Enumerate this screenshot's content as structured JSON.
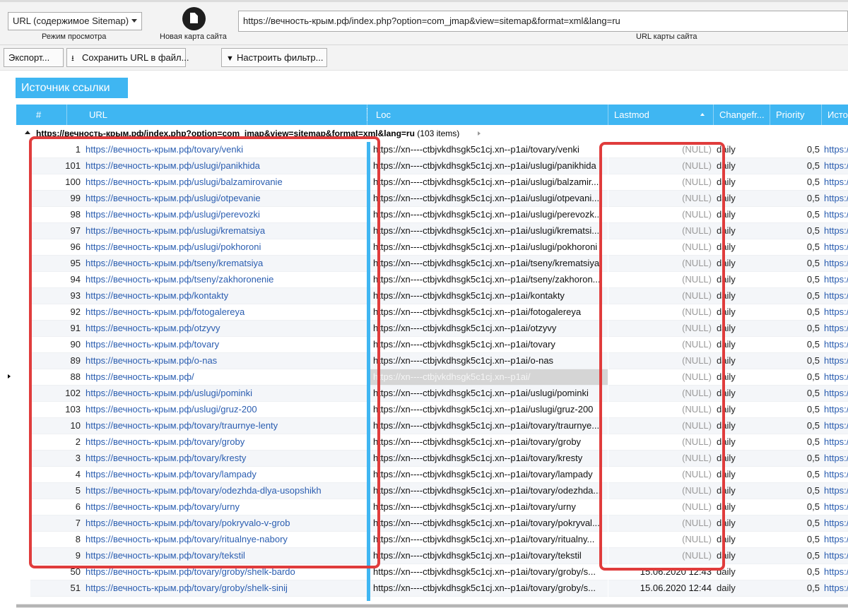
{
  "toolbar": {
    "view_mode_value": "URL (содержимое Sitemap)",
    "view_mode_caption": "Режим просмотра",
    "new_map_caption": "Новая карта сайта",
    "sitemap_url_value": "https://вечность-крым.рф/index.php?option=com_jmap&view=sitemap&format=xml&lang=ru",
    "sitemap_url_caption": "URL карты сайта",
    "export_label": "Экспорт...",
    "save_urls_label": "Сохранить URL в файл...",
    "filter_label": "Настроить фильтр..."
  },
  "group_panel": {
    "label": "Источник ссылки"
  },
  "grid": {
    "columns": {
      "num": "#",
      "url": "URL",
      "loc": "Loc",
      "lastmod": "Lastmod",
      "changefreq": "Changefr...",
      "priority": "Priority",
      "source": "Исто"
    },
    "group": {
      "title": "https://вечность-крым.рф/index.php?option=com_jmap&view=sitemap&format=xml&lang=ru",
      "count": "(103 items)"
    },
    "rows": [
      {
        "num": "1",
        "url": "https://вечность-крым.рф/tovary/venki",
        "loc": "https://xn----ctbjvkdhsgk5c1cj.xn--p1ai/tovary/venki",
        "lastmod": "(NULL)",
        "changefreq": "daily",
        "priority": "0,5",
        "source": "https:/"
      },
      {
        "num": "101",
        "url": "https://вечность-крым.рф/uslugi/panikhida",
        "loc": "https://xn----ctbjvkdhsgk5c1cj.xn--p1ai/uslugi/panikhida",
        "lastmod": "(NULL)",
        "changefreq": "daily",
        "priority": "0,5",
        "source": "https:/"
      },
      {
        "num": "100",
        "url": "https://вечность-крым.рф/uslugi/balzamirovanie",
        "loc": "https://xn----ctbjvkdhsgk5c1cj.xn--p1ai/uslugi/balzamir...",
        "lastmod": "(NULL)",
        "changefreq": "daily",
        "priority": "0,5",
        "source": "https:/"
      },
      {
        "num": "99",
        "url": "https://вечность-крым.рф/uslugi/otpevanie",
        "loc": "https://xn----ctbjvkdhsgk5c1cj.xn--p1ai/uslugi/otpevani...",
        "lastmod": "(NULL)",
        "changefreq": "daily",
        "priority": "0,5",
        "source": "https:/"
      },
      {
        "num": "98",
        "url": "https://вечность-крым.рф/uslugi/perevozki",
        "loc": "https://xn----ctbjvkdhsgk5c1cj.xn--p1ai/uslugi/perevozk...",
        "lastmod": "(NULL)",
        "changefreq": "daily",
        "priority": "0,5",
        "source": "https:/"
      },
      {
        "num": "97",
        "url": "https://вечность-крым.рф/uslugi/krematsiya",
        "loc": "https://xn----ctbjvkdhsgk5c1cj.xn--p1ai/uslugi/krematsi...",
        "lastmod": "(NULL)",
        "changefreq": "daily",
        "priority": "0,5",
        "source": "https:/"
      },
      {
        "num": "96",
        "url": "https://вечность-крым.рф/uslugi/pokhoroni",
        "loc": "https://xn----ctbjvkdhsgk5c1cj.xn--p1ai/uslugi/pokhoroni",
        "lastmod": "(NULL)",
        "changefreq": "daily",
        "priority": "0,5",
        "source": "https:/"
      },
      {
        "num": "95",
        "url": "https://вечность-крым.рф/tseny/krematsiya",
        "loc": "https://xn----ctbjvkdhsgk5c1cj.xn--p1ai/tseny/krematsiya",
        "lastmod": "(NULL)",
        "changefreq": "daily",
        "priority": "0,5",
        "source": "https:/"
      },
      {
        "num": "94",
        "url": "https://вечность-крым.рф/tseny/zakhoronenie",
        "loc": "https://xn----ctbjvkdhsgk5c1cj.xn--p1ai/tseny/zakhoron...",
        "lastmod": "(NULL)",
        "changefreq": "daily",
        "priority": "0,5",
        "source": "https:/"
      },
      {
        "num": "93",
        "url": "https://вечность-крым.рф/kontakty",
        "loc": "https://xn----ctbjvkdhsgk5c1cj.xn--p1ai/kontakty",
        "lastmod": "(NULL)",
        "changefreq": "daily",
        "priority": "0,5",
        "source": "https:/"
      },
      {
        "num": "92",
        "url": "https://вечность-крым.рф/fotogalereya",
        "loc": "https://xn----ctbjvkdhsgk5c1cj.xn--p1ai/fotogalereya",
        "lastmod": "(NULL)",
        "changefreq": "daily",
        "priority": "0,5",
        "source": "https:/"
      },
      {
        "num": "91",
        "url": "https://вечность-крым.рф/otzyvy",
        "loc": "https://xn----ctbjvkdhsgk5c1cj.xn--p1ai/otzyvy",
        "lastmod": "(NULL)",
        "changefreq": "daily",
        "priority": "0,5",
        "source": "https:/"
      },
      {
        "num": "90",
        "url": "https://вечность-крым.рф/tovary",
        "loc": "https://xn----ctbjvkdhsgk5c1cj.xn--p1ai/tovary",
        "lastmod": "(NULL)",
        "changefreq": "daily",
        "priority": "0,5",
        "source": "https:/"
      },
      {
        "num": "89",
        "url": "https://вечность-крым.рф/o-nas",
        "loc": "https://xn----ctbjvkdhsgk5c1cj.xn--p1ai/o-nas",
        "lastmod": "(NULL)",
        "changefreq": "daily",
        "priority": "0,5",
        "source": "https:/"
      },
      {
        "num": "88",
        "url": "https://вечность-крым.рф/",
        "loc": "https://xn----ctbjvkdhsgk5c1cj.xn--p1ai/",
        "lastmod": "(NULL)",
        "changefreq": "daily",
        "priority": "0,5",
        "source": "https:/",
        "selected": true
      },
      {
        "num": "102",
        "url": "https://вечность-крым.рф/uslugi/pominki",
        "loc": "https://xn----ctbjvkdhsgk5c1cj.xn--p1ai/uslugi/pominki",
        "lastmod": "(NULL)",
        "changefreq": "daily",
        "priority": "0,5",
        "source": "https:/"
      },
      {
        "num": "103",
        "url": "https://вечность-крым.рф/uslugi/gruz-200",
        "loc": "https://xn----ctbjvkdhsgk5c1cj.xn--p1ai/uslugi/gruz-200",
        "lastmod": "(NULL)",
        "changefreq": "daily",
        "priority": "0,5",
        "source": "https:/"
      },
      {
        "num": "10",
        "url": "https://вечность-крым.рф/tovary/traurnye-lenty",
        "loc": "https://xn----ctbjvkdhsgk5c1cj.xn--p1ai/tovary/traurnye...",
        "lastmod": "(NULL)",
        "changefreq": "daily",
        "priority": "0,5",
        "source": "https:/"
      },
      {
        "num": "2",
        "url": "https://вечность-крым.рф/tovary/groby",
        "loc": "https://xn----ctbjvkdhsgk5c1cj.xn--p1ai/tovary/groby",
        "lastmod": "(NULL)",
        "changefreq": "daily",
        "priority": "0,5",
        "source": "https:/"
      },
      {
        "num": "3",
        "url": "https://вечность-крым.рф/tovary/kresty",
        "loc": "https://xn----ctbjvkdhsgk5c1cj.xn--p1ai/tovary/kresty",
        "lastmod": "(NULL)",
        "changefreq": "daily",
        "priority": "0,5",
        "source": "https:/"
      },
      {
        "num": "4",
        "url": "https://вечность-крым.рф/tovary/lampady",
        "loc": "https://xn----ctbjvkdhsgk5c1cj.xn--p1ai/tovary/lampady",
        "lastmod": "(NULL)",
        "changefreq": "daily",
        "priority": "0,5",
        "source": "https:/"
      },
      {
        "num": "5",
        "url": "https://вечность-крым.рф/tovary/odezhda-dlya-usopshikh",
        "loc": "https://xn----ctbjvkdhsgk5c1cj.xn--p1ai/tovary/odezhda...",
        "lastmod": "(NULL)",
        "changefreq": "daily",
        "priority": "0,5",
        "source": "https:/"
      },
      {
        "num": "6",
        "url": "https://вечность-крым.рф/tovary/urny",
        "loc": "https://xn----ctbjvkdhsgk5c1cj.xn--p1ai/tovary/urny",
        "lastmod": "(NULL)",
        "changefreq": "daily",
        "priority": "0,5",
        "source": "https:/"
      },
      {
        "num": "7",
        "url": "https://вечность-крым.рф/tovary/pokryvalo-v-grob",
        "loc": "https://xn----ctbjvkdhsgk5c1cj.xn--p1ai/tovary/pokryval...",
        "lastmod": "(NULL)",
        "changefreq": "daily",
        "priority": "0,5",
        "source": "https:/"
      },
      {
        "num": "8",
        "url": "https://вечность-крым.рф/tovary/ritualnye-nabory",
        "loc": "https://xn----ctbjvkdhsgk5c1cj.xn--p1ai/tovary/ritualny...",
        "lastmod": "(NULL)",
        "changefreq": "daily",
        "priority": "0,5",
        "source": "https:/"
      },
      {
        "num": "9",
        "url": "https://вечность-крым.рф/tovary/tekstil",
        "loc": "https://xn----ctbjvkdhsgk5c1cj.xn--p1ai/tovary/tekstil",
        "lastmod": "(NULL)",
        "changefreq": "daily",
        "priority": "0,5",
        "source": "https:/"
      },
      {
        "num": "50",
        "url": "https://вечность-крым.рф/tovary/groby/shelk-bardo",
        "loc": "https://xn----ctbjvkdhsgk5c1cj.xn--p1ai/tovary/groby/s...",
        "lastmod": "15.06.2020 12:43",
        "changefreq": "daily",
        "priority": "0,5",
        "source": "https:/"
      },
      {
        "num": "51",
        "url": "https://вечность-крым.рф/tovary/groby/shelk-sinij",
        "loc": "https://xn----ctbjvkdhsgk5c1cj.xn--p1ai/tovary/groby/s...",
        "lastmod": "15.06.2020 12:44",
        "changefreq": "daily",
        "priority": "0,5",
        "source": "https:/"
      }
    ]
  },
  "colors": {
    "accent": "#3fb6f2",
    "link": "#2a5db0",
    "highlight": "#e03c3c",
    "null_text": "#9a9a9a"
  }
}
